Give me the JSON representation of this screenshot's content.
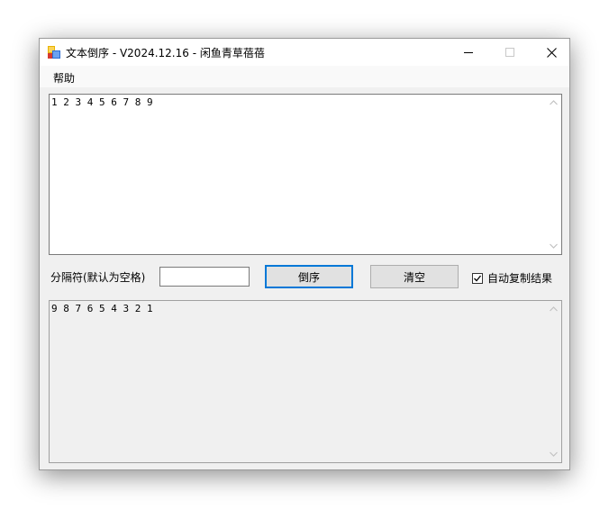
{
  "window": {
    "title": "文本倒序 - V2024.12.16 - 闲鱼青草蓓蓓"
  },
  "menu": {
    "help": "帮助"
  },
  "input": {
    "text": "1 2 3 4 5 6 7 8 9"
  },
  "separator": {
    "label": "分隔符(默认为空格)",
    "value": ""
  },
  "buttons": {
    "reverse": "倒序",
    "clear": "清空"
  },
  "auto_copy": {
    "label": "自动复制结果",
    "checked": true
  },
  "output": {
    "text": "9 8 7 6 5 4 3 2 1"
  },
  "colors": {
    "accent": "#0078d7",
    "window_bg": "#f0f0f0"
  }
}
